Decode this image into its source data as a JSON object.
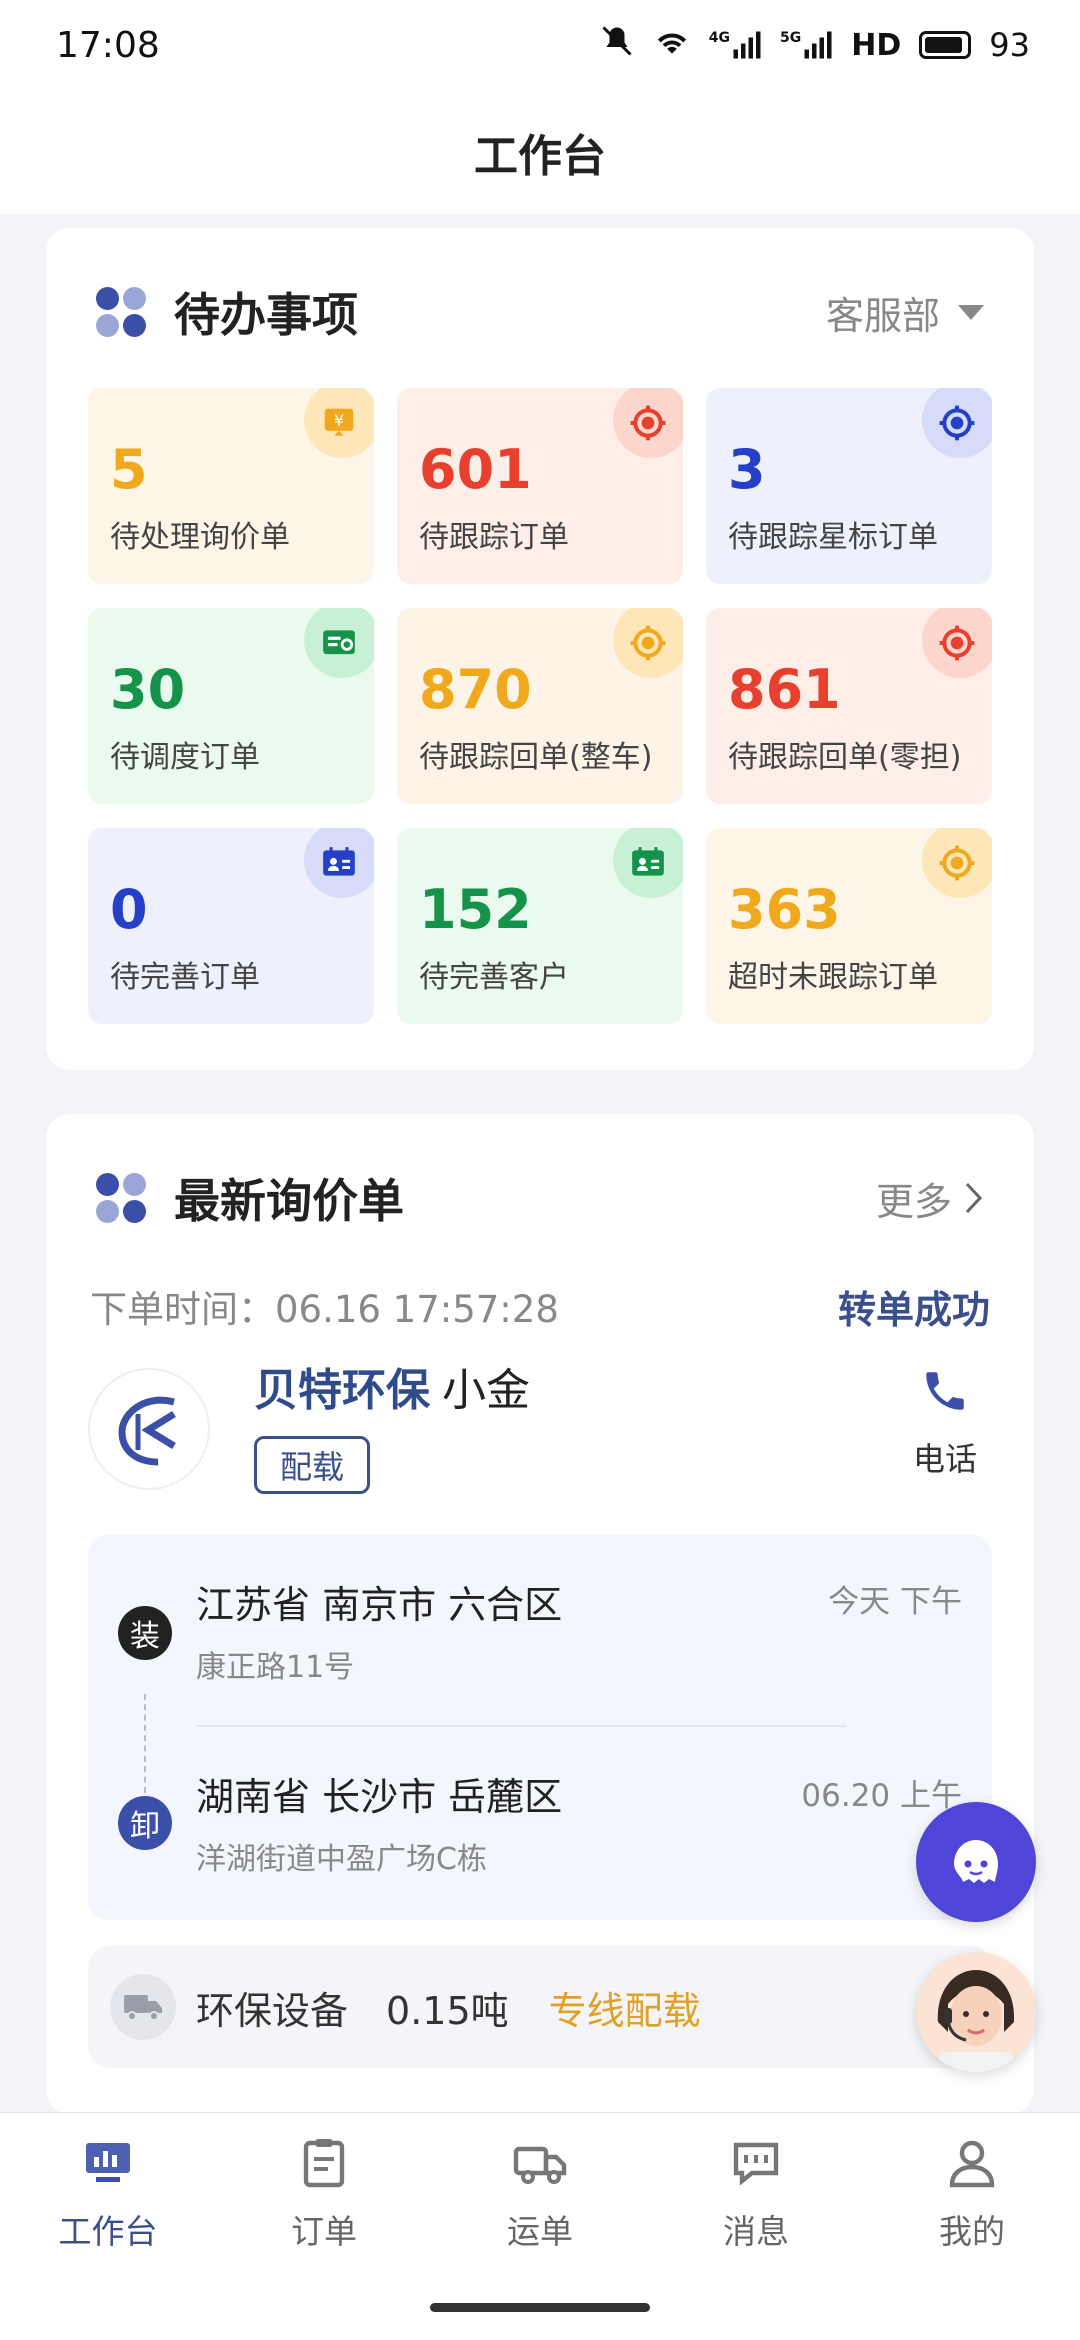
{
  "status_bar": {
    "time": "17:08",
    "network_4g": "4G",
    "network_5g": "5G",
    "hd": "HD",
    "battery": "93"
  },
  "header": {
    "title": "工作台"
  },
  "todo": {
    "title": "待办事项",
    "department": "客服部",
    "tiles": [
      {
        "count": "5",
        "label": "待处理询价单",
        "color": "#f0a81c",
        "bg": "#fdf6e8",
        "icon": "yen-tag-icon"
      },
      {
        "count": "601",
        "label": "待跟踪订单",
        "color": "#e8402e",
        "bg": "#fdeee8",
        "icon": "target-icon"
      },
      {
        "count": "3",
        "label": "待跟踪星标订单",
        "color": "#2440c8",
        "bg": "#eef0fb",
        "icon": "target-icon"
      },
      {
        "count": "30",
        "label": "待调度订单",
        "color": "#16934a",
        "bg": "#eafaef",
        "icon": "dispatch-icon"
      },
      {
        "count": "870",
        "label": "待跟踪回单(整车)",
        "color": "#f0a81c",
        "bg": "#fdf3e6",
        "icon": "target-icon"
      },
      {
        "count": "861",
        "label": "待跟踪回单(零担)",
        "color": "#e8402e",
        "bg": "#fdeee8",
        "icon": "target-icon"
      },
      {
        "count": "0",
        "label": "待完善订单",
        "color": "#2440c8",
        "bg": "#eef0fb",
        "icon": "id-card-icon"
      },
      {
        "count": "152",
        "label": "待完善客户",
        "color": "#16934a",
        "bg": "#eafaef",
        "icon": "id-card-icon"
      },
      {
        "count": "363",
        "label": "超时未跟踪订单",
        "color": "#f0a81c",
        "bg": "#fdf6e8",
        "icon": "target-icon"
      }
    ]
  },
  "inquiry": {
    "title": "最新询价单",
    "more": "更多",
    "order_time": "下单时间：06.16 17:57:28",
    "status": "转单成功",
    "company": "贝特环保",
    "contact": "小金",
    "tag": "配载",
    "phone_label": "电话",
    "load": {
      "badge": "装",
      "city": "江苏省 南京市 六合区",
      "address": "康正路11号",
      "time": "今天 下午"
    },
    "unload": {
      "badge": "卸",
      "city": "湖南省 长沙市 岳麓区",
      "address": "洋湖街道中盈广场C栋",
      "time": "06.20 上午"
    },
    "cargo_name": "环保设备",
    "cargo_weight": "0.15吨",
    "cargo_mode": "专线配载"
  },
  "nav": {
    "items": [
      {
        "label": "工作台",
        "icon": "dashboard-icon",
        "active": true
      },
      {
        "label": "订单",
        "icon": "clipboard-icon",
        "active": false
      },
      {
        "label": "运单",
        "icon": "truck-icon",
        "active": false
      },
      {
        "label": "消息",
        "icon": "message-icon",
        "active": false
      },
      {
        "label": "我的",
        "icon": "user-icon",
        "active": false
      }
    ]
  }
}
